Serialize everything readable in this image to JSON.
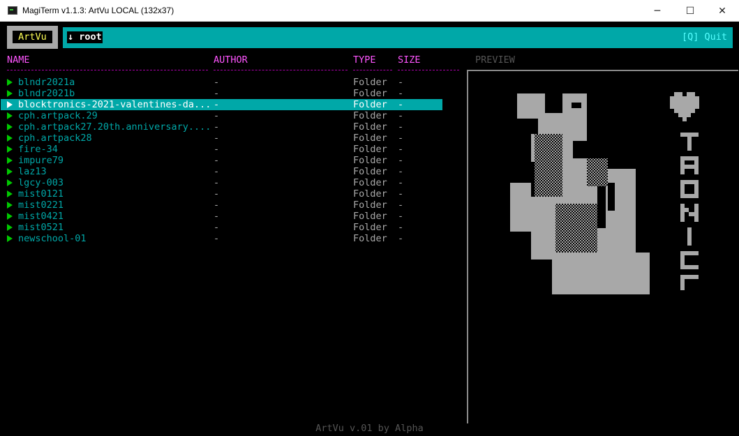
{
  "window": {
    "title": "MagiTerm v1.1.3: ArtVu LOCAL (132x37)",
    "minimize_glyph": "─",
    "maximize_glyph": "☐",
    "close_glyph": "✕"
  },
  "header": {
    "logo": "ArtVu",
    "path": "↓ root",
    "quit": "[Q] Quit"
  },
  "columns": {
    "name": "NAME",
    "author": "AUTHOR",
    "type": "TYPE",
    "size": "SIZE",
    "preview": "PREVIEW"
  },
  "rows": [
    {
      "name": "blndr2021a",
      "author": "-",
      "type": "Folder",
      "size": "-"
    },
    {
      "name": "blndr2021b",
      "author": "-",
      "type": "Folder",
      "size": "-"
    },
    {
      "name": "blocktronics-2021-valentines-da...",
      "author": "-",
      "type": "Folder",
      "size": "-"
    },
    {
      "name": "cph.artpack.29",
      "author": "-",
      "type": "Folder",
      "size": "-"
    },
    {
      "name": "cph.artpack27.20th.anniversary....",
      "author": "-",
      "type": "Folder",
      "size": "-"
    },
    {
      "name": "cph.artpack28",
      "author": "-",
      "type": "Folder",
      "size": "-"
    },
    {
      "name": "fire-34",
      "author": "-",
      "type": "Folder",
      "size": "-"
    },
    {
      "name": "impure79",
      "author": "-",
      "type": "Folder",
      "size": "-"
    },
    {
      "name": "laz13",
      "author": "-",
      "type": "Folder",
      "size": "-"
    },
    {
      "name": "lgcy-003",
      "author": "-",
      "type": "Folder",
      "size": "-"
    },
    {
      "name": "mist0121",
      "author": "-",
      "type": "Folder",
      "size": "-"
    },
    {
      "name": "mist0221",
      "author": "-",
      "type": "Folder",
      "size": "-"
    },
    {
      "name": "mist0421",
      "author": "-",
      "type": "Folder",
      "size": "-"
    },
    {
      "name": "mist0521",
      "author": "-",
      "type": "Folder",
      "size": "-"
    },
    {
      "name": "newschool-01",
      "author": "-",
      "type": "Folder",
      "size": "-"
    }
  ],
  "selected_index": 2,
  "footer": "ArtVu v.01 by Alpha",
  "colors": {
    "accent": "#00a8a8",
    "header_magenta": "#ff55ff",
    "arrow_green": "#00c800",
    "logo_yellow": "#ffff55",
    "art_gray": "#a8a8a8"
  }
}
